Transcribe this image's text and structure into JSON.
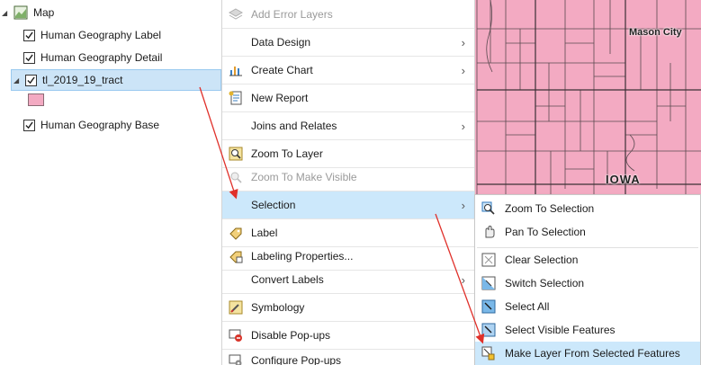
{
  "map": {
    "labels": {
      "city": "Mason City",
      "state": "IOWA"
    },
    "fill_color": "#f3aac2"
  },
  "toc": {
    "map_label": "Map",
    "layers": [
      {
        "label": "Human Geography Label",
        "checked": true
      },
      {
        "label": "Human Geography Detail",
        "checked": true
      },
      {
        "label": "tl_2019_19_tract",
        "checked": true,
        "selected": true
      },
      {
        "label": "Human Geography Base",
        "checked": true
      }
    ]
  },
  "context_menu": {
    "items": [
      {
        "label": "Add Error Layers",
        "icon": "error-layers-icon",
        "disabled": true
      },
      {
        "label": "Data Design",
        "submenu": true
      },
      {
        "label": "Create Chart",
        "icon": "chart-icon",
        "submenu": true
      },
      {
        "label": "New Report",
        "icon": "report-icon"
      },
      {
        "label": "Joins and Relates",
        "submenu": true
      },
      {
        "label": "Zoom To Layer",
        "icon": "zoom-layer-icon"
      },
      {
        "label": "Zoom To Make Visible",
        "icon": "zoom-visible-icon",
        "disabled": true
      },
      {
        "label": "Selection",
        "submenu": true,
        "highlighted": true
      },
      {
        "label": "Label",
        "icon": "label-icon"
      },
      {
        "label": "Labeling Properties...",
        "icon": "labeling-properties-icon"
      },
      {
        "label": "Convert Labels",
        "submenu": true
      },
      {
        "label": "Symbology",
        "icon": "symbology-icon"
      },
      {
        "label": "Disable Pop-ups",
        "icon": "disable-popups-icon"
      },
      {
        "label": "Configure Pop-ups",
        "icon": "configure-popups-icon"
      }
    ],
    "submenu_arrow": "›"
  },
  "selection_submenu": {
    "items": [
      {
        "label": "Zoom To Selection",
        "icon": "zoom-selection-icon"
      },
      {
        "label": "Pan To Selection",
        "icon": "pan-selection-icon"
      },
      {
        "label": "Clear Selection",
        "icon": "clear-selection-icon"
      },
      {
        "label": "Switch Selection",
        "icon": "switch-selection-icon"
      },
      {
        "label": "Select All",
        "icon": "select-all-icon"
      },
      {
        "label": "Select Visible Features",
        "icon": "select-visible-icon"
      },
      {
        "label": "Make Layer From Selected Features",
        "icon": "make-layer-icon",
        "highlighted": true
      }
    ]
  },
  "colors": {
    "highlight": "#cce8fb",
    "annotation_arrow": "#e0302a",
    "selected_row": "#cce4f7"
  }
}
